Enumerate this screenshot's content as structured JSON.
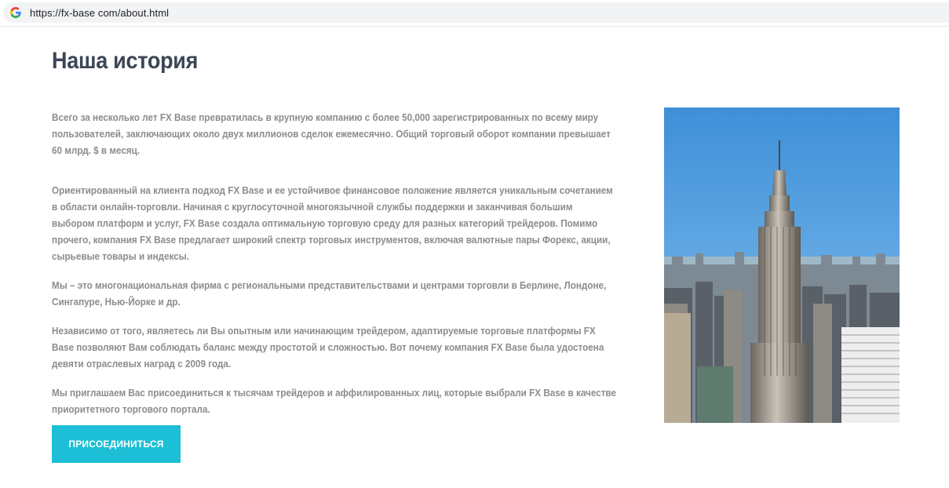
{
  "browser": {
    "url": "https://fx-base com/about.html",
    "favicon_icon": "google-g-icon"
  },
  "page": {
    "title": "Наша история",
    "paragraphs": [
      "Всего за несколько лет FX Base превратилась в крупную компанию с более 50,000 зарегистрированных по всему миру пользователей, заключающих около двух миллионов сделок ежемесячно. Общий торговый оборот компании превышает 60 млрд. $ в месяц.",
      "Ориентированный на клиента подход FX Base и ее устойчивое финансовое положение является уникальным сочетанием в области онлайн-торговли. Начиная с круглосуточной многоязычной службы поддержки и заканчивая большим выбором платформ и услуг, FX Base создала оптимальную торговую среду для разных категорий трейдеров. Помимо прочего, компания FX Base предлагает широкий спектр торговых инструментов, включая валютные пары Форекс, акции, сырьевые товары и индексы.",
      "Мы – это многонациональная фирма с региональными представительствами и центрами торговли в Берлине, Лондоне, Сингапуре, Нью-Йорке и др.",
      "Независимо от того, являетесь ли Вы опытным или начинающим трейдером, адаптируемые торговые платформы FX Base позволяют Вам соблюдать баланс между простотой и сложностью. Вот почему компания FX Base была удостоена девяти отраслевых наград с 2009 года.",
      "Мы приглашаем Вас присоединиться к тысячам трейдеров и аффилированных лиц, которые выбрали FX Base в качестве приоритетного торгового портала."
    ],
    "join_button_label": "ПРИСОЕДИНИТЬСЯ",
    "image_subject": "empire-state-building-photo"
  },
  "colors": {
    "title": "#3c4655",
    "body_text": "#8c8c8c",
    "button_bg": "#1cbfd5",
    "button_text": "#ffffff",
    "url_bar_bg": "#f1f3f4"
  }
}
